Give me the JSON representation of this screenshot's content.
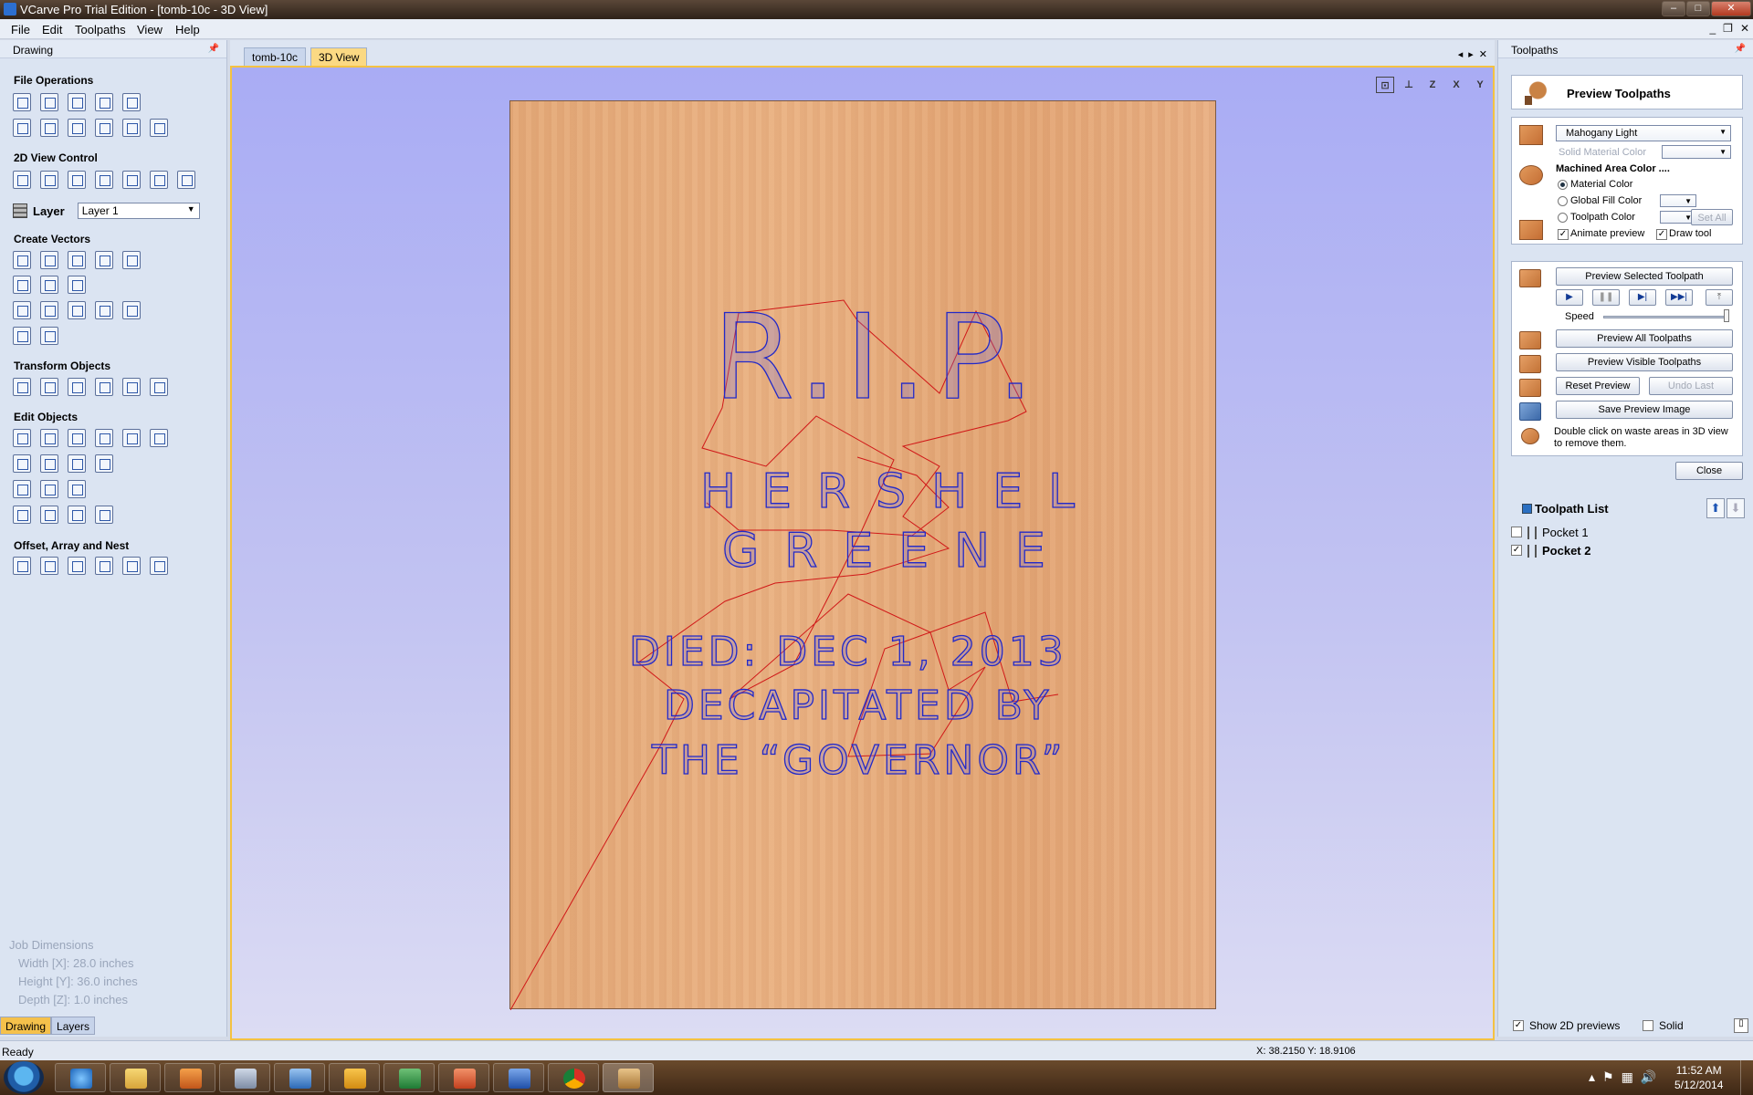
{
  "window": {
    "title": "VCarve Pro Trial Edition - [tomb-10c - 3D View]"
  },
  "menu": [
    "File",
    "Edit",
    "Toolpaths",
    "View",
    "Help"
  ],
  "left_panel": {
    "header": "Drawing",
    "sections": {
      "file_ops": "File Operations",
      "view_2d": "2D View Control",
      "create_vectors": "Create Vectors",
      "transform": "Transform Objects",
      "edit_objects": "Edit Objects",
      "offset_array": "Offset, Array and Nest"
    },
    "layer_label": "Layer",
    "layer_value": "Layer 1",
    "job": {
      "title": "Job Dimensions",
      "width": "Width  [X]: 28.0 inches",
      "height": "Height [Y]: 36.0 inches",
      "depth": "Depth  [Z]: 1.0 inches"
    },
    "tabs": [
      "Drawing",
      "Layers"
    ]
  },
  "doc_tabs": [
    "tomb-10c",
    "3D View"
  ],
  "view_tools": [
    "Z",
    "X",
    "Y"
  ],
  "carving": {
    "line1": "R.I.P.",
    "line2": "HERSHEL",
    "line3": "GREENE",
    "line4": "DIED: DEC 1, 2013",
    "line5": "DECAPITATED BY",
    "line6": "THE “GOVERNOR”"
  },
  "right_panel": {
    "header": "Toolpaths",
    "preview_title": "Preview Toolpaths",
    "material": "Mahogany Light",
    "solid_material_color": "Solid Material Color",
    "machined_area_color": "Machined Area Color ....",
    "radio_material": "Material Color",
    "radio_global": "Global Fill Color",
    "radio_toolpath": "Toolpath Color",
    "set_all": "Set All",
    "animate_preview": "Animate preview",
    "draw_tool": "Draw tool",
    "preview_selected": "Preview Selected Toolpath",
    "speed": "Speed",
    "preview_all": "Preview All Toolpaths",
    "preview_visible": "Preview Visible Toolpaths",
    "reset_preview": "Reset Preview",
    "undo_last": "Undo Last",
    "save_preview": "Save Preview Image",
    "hint_line1": "Double click on waste areas in 3D view",
    "hint_line2": "to remove them.",
    "close": "Close",
    "toolpath_list_title": "Toolpath List",
    "toolpaths": [
      {
        "name": "Pocket 1",
        "checked": false
      },
      {
        "name": "Pocket 2",
        "checked": true
      }
    ],
    "show_2d": "Show 2D previews",
    "solid": "Solid"
  },
  "status": {
    "text": "Ready",
    "coords": "X: 38.2150 Y: 18.9106"
  },
  "clock": {
    "time": "11:52 AM",
    "date": "5/12/2014"
  }
}
